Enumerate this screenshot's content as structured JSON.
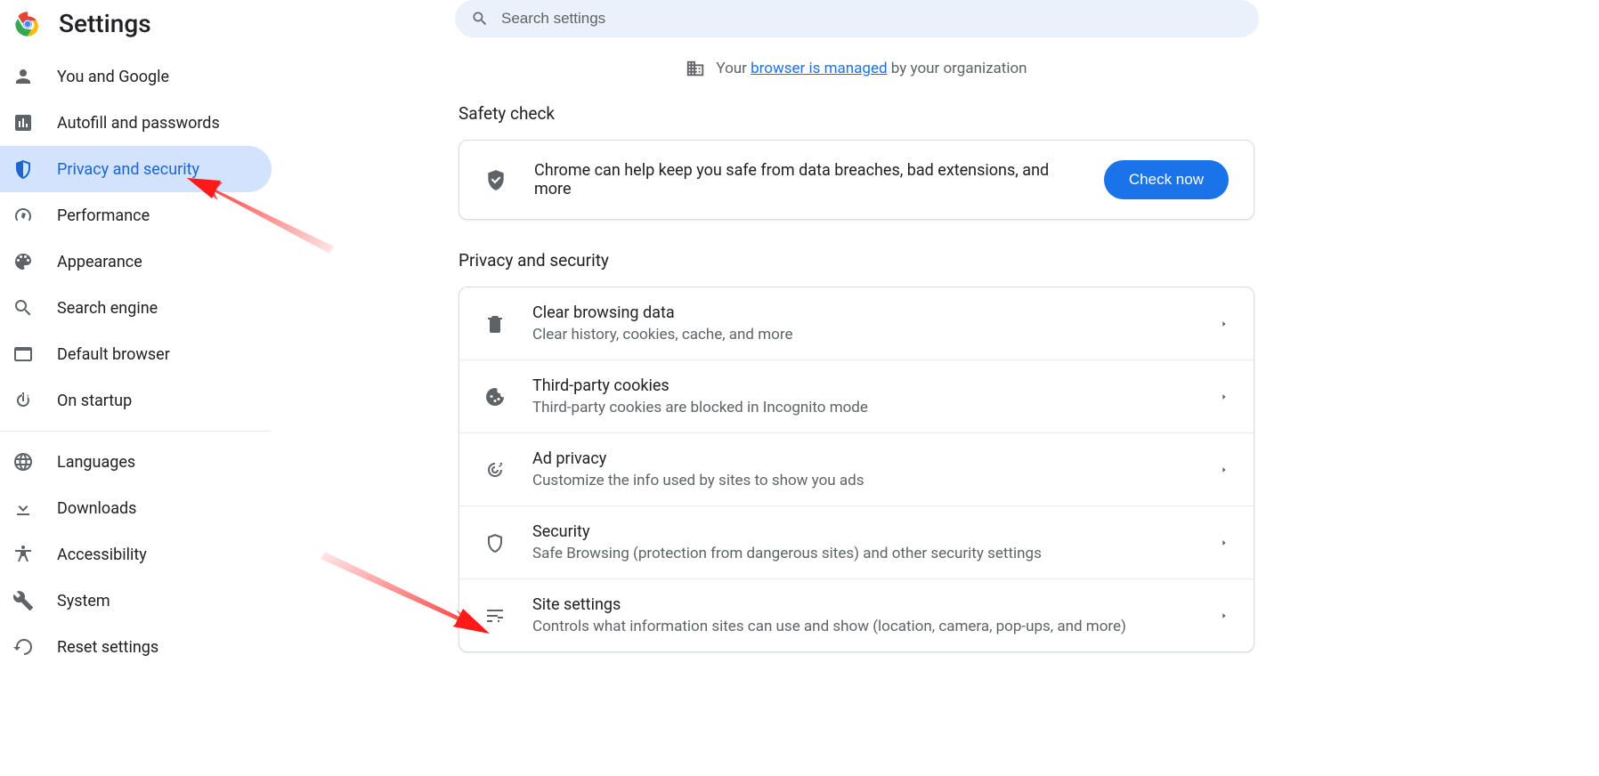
{
  "header": {
    "title": "Settings"
  },
  "search": {
    "placeholder": "Search settings"
  },
  "sidebar": {
    "items": [
      {
        "label": "You and Google",
        "icon": "person",
        "active": false
      },
      {
        "label": "Autofill and passwords",
        "icon": "autofill",
        "active": false
      },
      {
        "label": "Privacy and security",
        "icon": "shield",
        "active": true
      },
      {
        "label": "Performance",
        "icon": "speedometer",
        "active": false
      },
      {
        "label": "Appearance",
        "icon": "palette",
        "active": false
      },
      {
        "label": "Search engine",
        "icon": "search",
        "active": false
      },
      {
        "label": "Default browser",
        "icon": "browser",
        "active": false
      },
      {
        "label": "On startup",
        "icon": "power",
        "active": false
      }
    ],
    "items2": [
      {
        "label": "Languages",
        "icon": "globe"
      },
      {
        "label": "Downloads",
        "icon": "download"
      },
      {
        "label": "Accessibility",
        "icon": "accessibility"
      },
      {
        "label": "System",
        "icon": "wrench"
      },
      {
        "label": "Reset settings",
        "icon": "reset"
      }
    ]
  },
  "managed": {
    "prefix": "Your ",
    "link": "browser is managed",
    "suffix": " by your organization"
  },
  "safety": {
    "section_title": "Safety check",
    "text": "Chrome can help keep you safe from data breaches, bad extensions, and more",
    "button": "Check now"
  },
  "privacy": {
    "section_title": "Privacy and security",
    "rows": [
      {
        "title": "Clear browsing data",
        "subtitle": "Clear history, cookies, cache, and more",
        "icon": "trash"
      },
      {
        "title": "Third-party cookies",
        "subtitle": "Third-party cookies are blocked in Incognito mode",
        "icon": "cookie"
      },
      {
        "title": "Ad privacy",
        "subtitle": "Customize the info used by sites to show you ads",
        "icon": "target"
      },
      {
        "title": "Security",
        "subtitle": "Safe Browsing (protection from dangerous sites) and other security settings",
        "icon": "shield-outline"
      },
      {
        "title": "Site settings",
        "subtitle": "Controls what information sites can use and show (location, camera, pop-ups, and more)",
        "icon": "tune"
      }
    ]
  }
}
